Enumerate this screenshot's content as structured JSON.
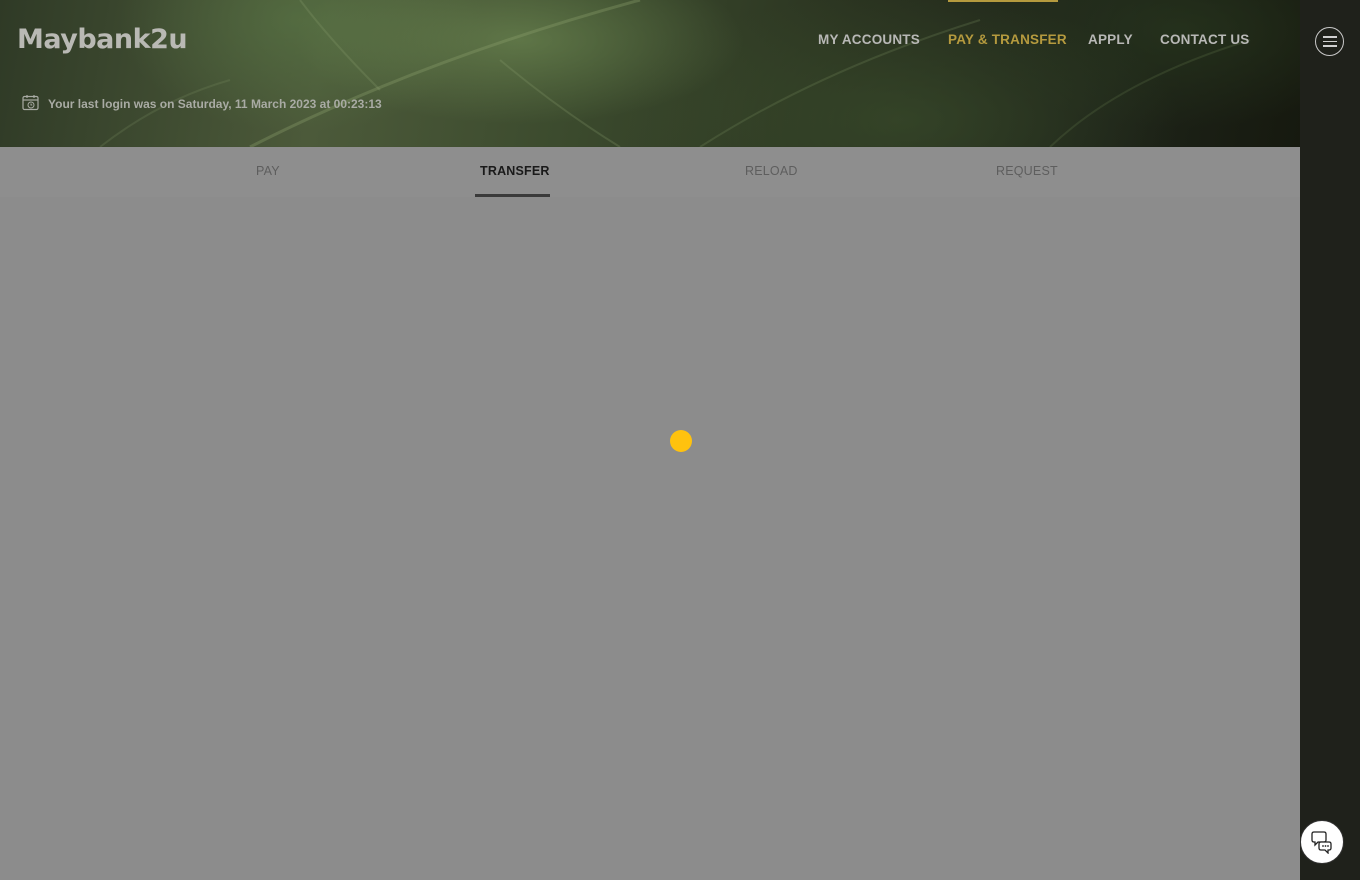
{
  "header": {
    "logo_text": "Maybank2u",
    "last_login": "Your last login was on Saturday, 11 March 2023 at 00:23:13"
  },
  "topnav": {
    "items": [
      {
        "label": "MY ACCOUNTS",
        "active": false
      },
      {
        "label": "PAY & TRANSFER",
        "active": true
      },
      {
        "label": "APPLY",
        "active": false
      },
      {
        "label": "CONTACT US",
        "active": false
      }
    ]
  },
  "subtabs": {
    "items": [
      {
        "label": "PAY",
        "active": false
      },
      {
        "label": "TRANSFER",
        "active": true
      },
      {
        "label": "RELOAD",
        "active": false
      },
      {
        "label": "REQUEST",
        "active": false
      }
    ]
  },
  "icons": {
    "menu": "hamburger-menu-icon",
    "chat": "chat-bubble-icon",
    "calendar": "calendar-clock-icon",
    "loading": "loading-spinner"
  },
  "colors": {
    "accent": "#b59a3e",
    "spinner": "#ffc20e",
    "overlay": "#8c8c8c",
    "rail": "#1f211b"
  }
}
